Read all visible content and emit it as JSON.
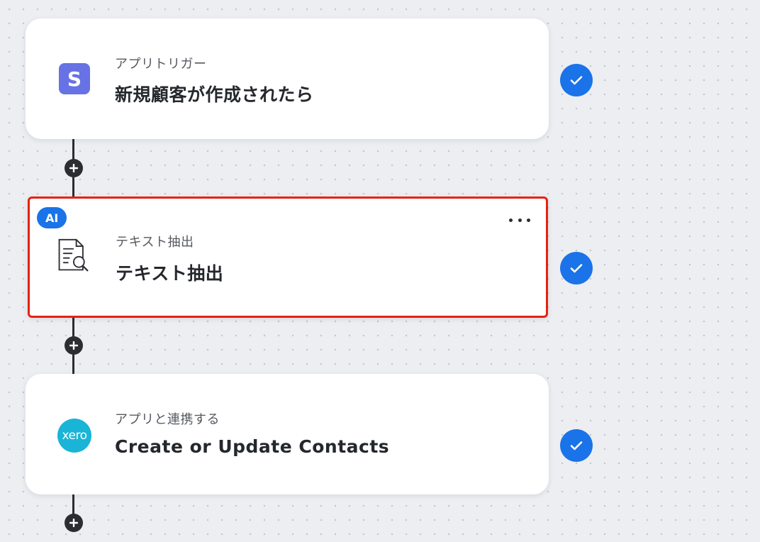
{
  "steps": [
    {
      "subtitle": "アプリトリガー",
      "title": "新規顧客が作成されたら",
      "icon": "stripe-logo-icon",
      "icon_text": "S",
      "status": "completed"
    },
    {
      "badge": "AI",
      "subtitle": "テキスト抽出",
      "title": "テキスト抽出",
      "icon": "document-search-icon",
      "status": "completed",
      "selected": true
    },
    {
      "subtitle": "アプリと連携する",
      "title": "Create or Update Contacts",
      "icon": "xero-logo-icon",
      "icon_text": "xero",
      "status": "completed"
    }
  ],
  "colors": {
    "accent": "#1a73e8",
    "selection": "#e8210f",
    "stripe": "#6772e5",
    "xero": "#1ab4d7",
    "connector": "#2b2d31"
  }
}
